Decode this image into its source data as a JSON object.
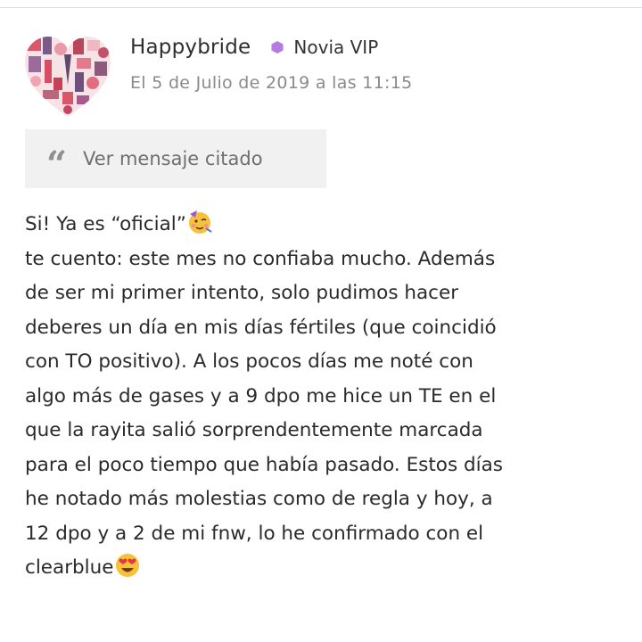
{
  "post": {
    "author": "Happybride",
    "badge": "Novia VIP",
    "timestamp": "El 5 de Julio de 2019 a las 11:15",
    "quote_label": "Ver mensaje citado",
    "message_lines": [
      "Si! Ya es “oficial”",
      "te cuento: este mes no confiaba mucho. Además",
      "de ser mi primer intento, solo pudimos hacer",
      "deberes un día en mis días fértiles (que coincidió",
      "con TO positivo). A los pocos días me noté con",
      "algo más de gases y a 9 dpo me hice un TE en el",
      "que la rayita salió sorprendentemente marcada",
      "para el poco tiempo que había pasado. Estos días",
      "he notado más molestias como de regla y hoy, a",
      "12 dpo y a 2 de mi fnw, lo he confirmado con el",
      "clearblue"
    ]
  },
  "icons": {
    "avatar": "heart-collage-avatar",
    "badge": "purple-hexagon-icon",
    "quote": "quote-icon",
    "emoji_party": "partying-face-emoji",
    "emoji_love": "heart-eyes-emoji"
  },
  "colors": {
    "badge": "#b57be0",
    "quote_bg": "#f1f1f1",
    "timestamp": "#8a8a8a"
  }
}
